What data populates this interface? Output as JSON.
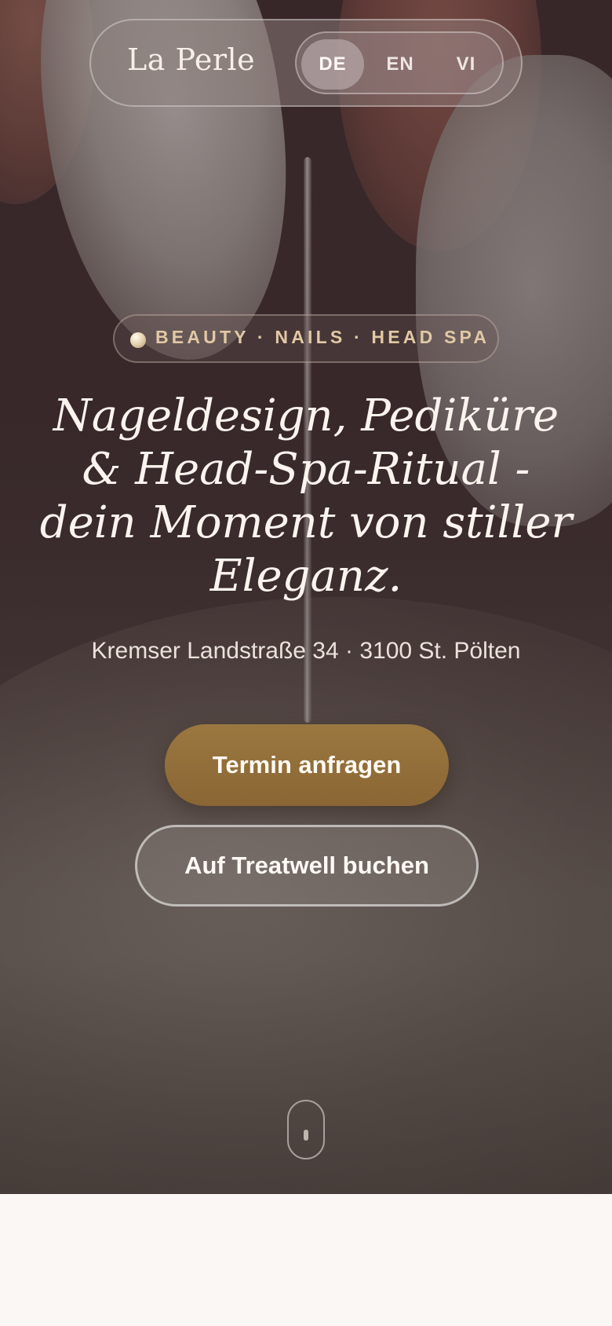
{
  "header": {
    "brand": "La Perle",
    "languages": [
      {
        "code": "DE",
        "active": true
      },
      {
        "code": "EN",
        "active": false
      },
      {
        "code": "VI",
        "active": false
      }
    ]
  },
  "hero": {
    "tag": "BEAUTY · NAILS · HEAD SPA",
    "headline": "Nageldesign, Pediküre & Head-Spa-Ritual - dein Moment von stiller Eleganz.",
    "address": "Kremser Landstraße 34 · 3100 St. Pölten",
    "primary_cta": "Termin anfragen",
    "secondary_cta": "Auf Treatwell buchen"
  },
  "colors": {
    "accent_gold": "#8f6b37",
    "tag_text": "#e2c9a4",
    "page_background": "#faf7f4"
  },
  "icons": {
    "tag_icon": "pearl-icon",
    "scroll_icon": "mouse-scroll-icon"
  }
}
